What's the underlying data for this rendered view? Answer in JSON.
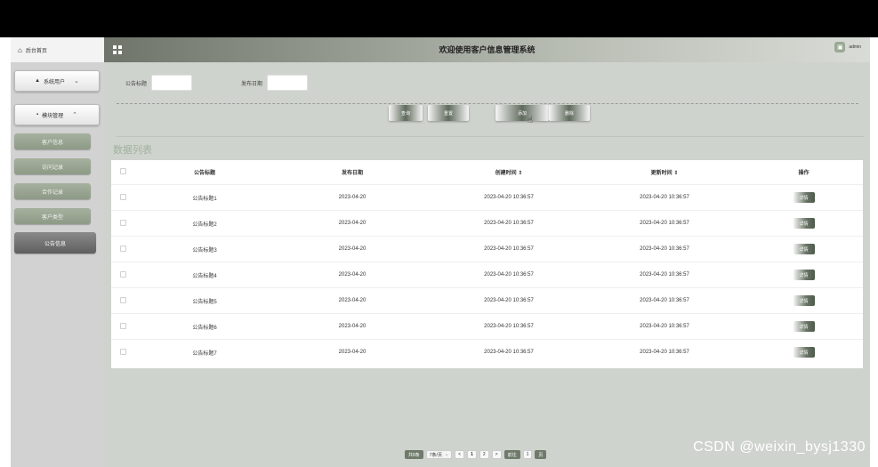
{
  "sidebar": {
    "home_label": "后台首页",
    "groups": [
      {
        "label": "系统用户",
        "icon": "user-icon",
        "chevron": "chevron-down-icon"
      },
      {
        "label": "模块管理",
        "icon": "grid-icon",
        "chevron": "chevron-up-icon"
      }
    ],
    "items": [
      {
        "label": "客户信息"
      },
      {
        "label": "访问记录"
      },
      {
        "label": "合作记录"
      },
      {
        "label": "客户类型"
      },
      {
        "label": "公告信息",
        "active": true
      }
    ]
  },
  "header": {
    "title": "欢迎使用客户信息管理系统",
    "user": "admin"
  },
  "search": {
    "title_label": "公告标题",
    "date_label": "发布日期"
  },
  "buttons": {
    "query": "查询",
    "reset": "重置",
    "add": "添加",
    "delete": "删除"
  },
  "section_title": "数据列表",
  "table": {
    "columns": [
      "公告标题",
      "发布日期",
      "创建时间 ⇕",
      "更新时间 ⇕",
      "操作"
    ],
    "rows": [
      {
        "title": "公告标题1",
        "date": "2023-04-20",
        "created": "2023-04-20 10:36:57",
        "updated": "2023-04-20 10:36:57",
        "action": "详情"
      },
      {
        "title": "公告标题2",
        "date": "2023-04-20",
        "created": "2023-04-20 10:36:57",
        "updated": "2023-04-20 10:36:57",
        "action": "详情"
      },
      {
        "title": "公告标题3",
        "date": "2023-04-20",
        "created": "2023-04-20 10:36:57",
        "updated": "2023-04-20 10:36:57",
        "action": "详情"
      },
      {
        "title": "公告标题4",
        "date": "2023-04-20",
        "created": "2023-04-20 10:36:57",
        "updated": "2023-04-20 10:36:57",
        "action": "详情"
      },
      {
        "title": "公告标题5",
        "date": "2023-04-20",
        "created": "2023-04-20 10:36:57",
        "updated": "2023-04-20 10:36:57",
        "action": "详情"
      },
      {
        "title": "公告标题6",
        "date": "2023-04-20",
        "created": "2023-04-20 10:36:57",
        "updated": "2023-04-20 10:36:57",
        "action": "详情"
      },
      {
        "title": "公告标题7",
        "date": "2023-04-20",
        "created": "2023-04-20 10:36:57",
        "updated": "2023-04-20 10:36:57",
        "action": "详情"
      }
    ]
  },
  "pagination": {
    "total": "共8条",
    "page_size": "7条/页",
    "prev": "<",
    "pages": [
      "1",
      "2"
    ],
    "next": ">",
    "goto_label": "前往",
    "goto_value": "1",
    "page_suffix": "页"
  },
  "watermark": "CSDN @weixin_bysj1330",
  "colors": {
    "accent": "#6f7a6b",
    "sidebar_item": "#9aa693",
    "section_title": "#9fb29d"
  }
}
